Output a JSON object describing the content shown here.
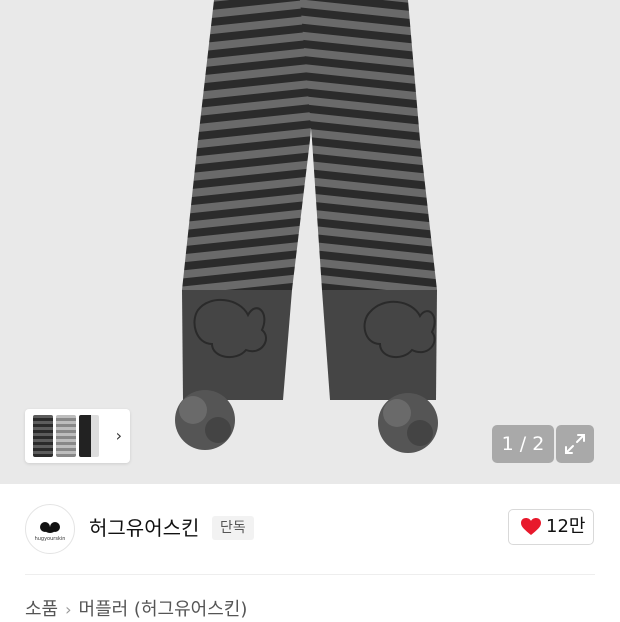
{
  "gallery": {
    "counter": "1 / 2",
    "icons": {
      "thumbnail_next": "chevron-right-icon",
      "expand": "expand-icon"
    }
  },
  "brand": {
    "name": "허그유어스킨",
    "badge": "단독",
    "logo_text": "hugyourskin"
  },
  "like": {
    "count": "12만",
    "icon": "heart-icon",
    "color": "#e8192c"
  },
  "breadcrumb": {
    "items": [
      "소품",
      "머플러 (허그유어스킨)"
    ]
  }
}
